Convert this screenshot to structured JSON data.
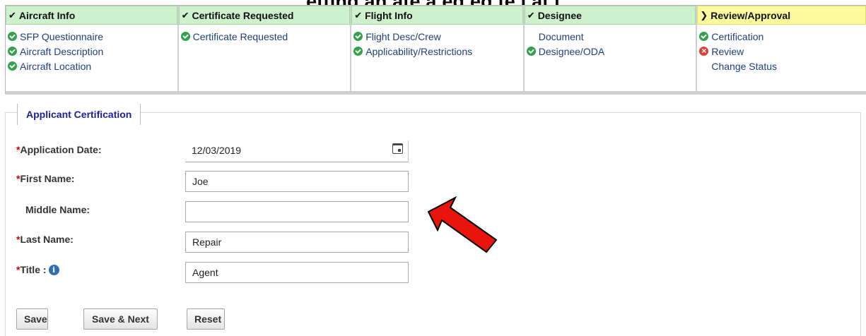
{
  "top_heading": "etting an  ate  a  eq  ed  te  l   at  l",
  "steps": [
    {
      "title": "Aircraft Info",
      "marker": "check",
      "active": false,
      "items": [
        {
          "label": "SFP Questionnaire",
          "status": "complete"
        },
        {
          "label": "Aircraft Description",
          "status": "complete"
        },
        {
          "label": "Aircraft Location",
          "status": "complete"
        }
      ]
    },
    {
      "title": "Certificate Requested",
      "marker": "check",
      "active": false,
      "items": [
        {
          "label": "Certificate Requested",
          "status": "complete"
        }
      ]
    },
    {
      "title": "Flight Info",
      "marker": "check",
      "active": false,
      "items": [
        {
          "label": "Flight Desc/Crew",
          "status": "complete"
        },
        {
          "label": "Applicability/Restrictions",
          "status": "complete"
        }
      ]
    },
    {
      "title": "Designee",
      "marker": "check",
      "active": false,
      "items": [
        {
          "label": "Document",
          "status": "none"
        },
        {
          "label": "Designee/ODA",
          "status": "complete"
        }
      ]
    },
    {
      "title": "Review/Approval",
      "marker": "chevron",
      "active": true,
      "items": [
        {
          "label": "Certification",
          "status": "complete"
        },
        {
          "label": "Review",
          "status": "error"
        },
        {
          "label": "Change Status",
          "status": "none"
        }
      ]
    }
  ],
  "form": {
    "legend": "Applicant Certification",
    "required_marker": "*",
    "fields": {
      "application_date": {
        "label": "Application Date:",
        "value": "12/03/2019",
        "required": true
      },
      "first_name": {
        "label": "First Name:",
        "value": "Joe",
        "required": true
      },
      "middle_name": {
        "label": "Middle Name:",
        "value": "",
        "required": false
      },
      "last_name": {
        "label": "Last Name:",
        "value": "Repair",
        "required": true
      },
      "title": {
        "label": "Title :",
        "value": "Agent",
        "required": true
      }
    },
    "info_glyph": "i"
  },
  "buttons": {
    "save": "Save",
    "save_next": "Save & Next",
    "reset": "Reset"
  },
  "colors": {
    "step_complete_bg": "#cdf0cd",
    "step_active_bg": "#fafa9c",
    "status_ok": "#2fa24a",
    "status_error": "#d9403b",
    "legend_text": "#1b1f9c",
    "annotation_arrow": "#e8150f"
  },
  "icons": {
    "step_complete": "check-icon",
    "step_active": "chevron-right-icon",
    "item_complete": "check-circle-icon",
    "item_error": "x-circle-icon",
    "date_picker": "calendar-icon",
    "title_help": "info-icon",
    "annotation": "arrow-pointer-icon"
  }
}
